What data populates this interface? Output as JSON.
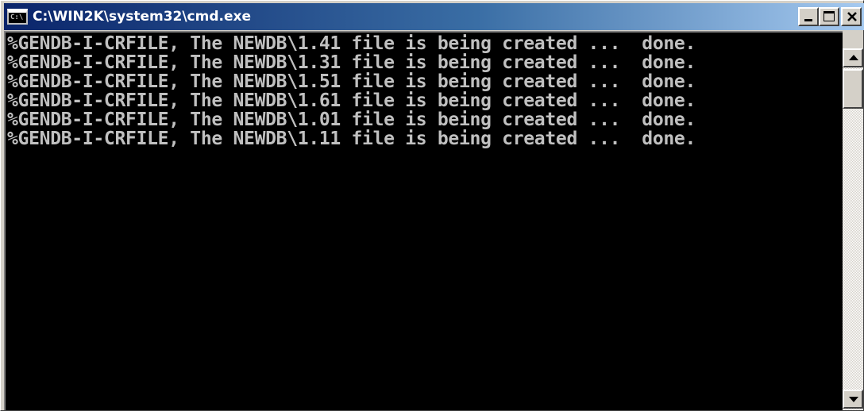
{
  "window": {
    "title": "C:\\WIN2K\\system32\\cmd.exe",
    "icon": "console-window-icon",
    "icon_label": "C:\\"
  },
  "console": {
    "text_color": "#c0c0c0",
    "background": "#000000",
    "lines": [
      "%GENDB-I-CRFILE, The NEWDB\\1.41 file is being created ...  done.",
      "%GENDB-I-CRFILE, The NEWDB\\1.31 file is being created ...  done.",
      "%GENDB-I-CRFILE, The NEWDB\\1.51 file is being created ...  done.",
      "%GENDB-I-CRFILE, The NEWDB\\1.61 file is being created ...  done.",
      "%GENDB-I-CRFILE, The NEWDB\\1.01 file is being created ...  done.",
      "%GENDB-I-CRFILE, The NEWDB\\1.11 file is being created ...  done."
    ]
  },
  "controls": {
    "minimize_icon": "minimize-icon",
    "maximize_icon": "maximize-icon",
    "close_icon": "close-icon",
    "scroll_up_icon": "arrow-up-icon",
    "scroll_down_icon": "arrow-down-icon"
  },
  "colors": {
    "title_gradient_start": "#0a246a",
    "title_gradient_end": "#a6caf0",
    "chrome": "#d4d0c8"
  }
}
